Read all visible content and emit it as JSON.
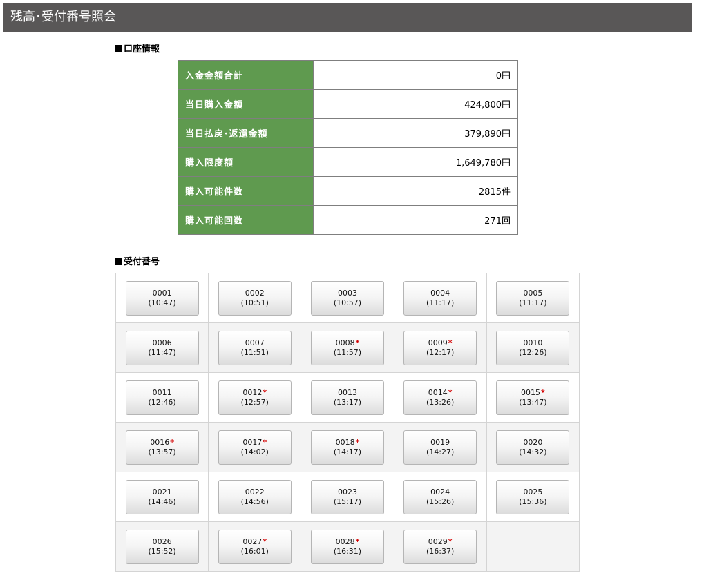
{
  "page_title": "残高･受付番号照会",
  "account_section": {
    "heading": "口座情報",
    "rows": [
      {
        "label": "入金金額合計",
        "value": "0円"
      },
      {
        "label": "当日購入金額",
        "value": "424,800円"
      },
      {
        "label": "当日払戻･返還金額",
        "value": "379,890円"
      },
      {
        "label": "購入限度額",
        "value": "1,649,780円"
      },
      {
        "label": "購入可能件数",
        "value": "2815件"
      },
      {
        "label": "購入可能回数",
        "value": "271回"
      }
    ]
  },
  "reception_section": {
    "heading": "受付番号",
    "star_mark": "*",
    "slots": [
      {
        "number": "0001",
        "time": "(10:47)",
        "starred": false
      },
      {
        "number": "0002",
        "time": "(10:51)",
        "starred": false
      },
      {
        "number": "0003",
        "time": "(10:57)",
        "starred": false
      },
      {
        "number": "0004",
        "time": "(11:17)",
        "starred": false
      },
      {
        "number": "0005",
        "time": "(11:17)",
        "starred": false
      },
      {
        "number": "0006",
        "time": "(11:47)",
        "starred": false
      },
      {
        "number": "0007",
        "time": "(11:51)",
        "starred": false
      },
      {
        "number": "0008",
        "time": "(11:57)",
        "starred": true
      },
      {
        "number": "0009",
        "time": "(12:17)",
        "starred": true
      },
      {
        "number": "0010",
        "time": "(12:26)",
        "starred": false
      },
      {
        "number": "0011",
        "time": "(12:46)",
        "starred": false
      },
      {
        "number": "0012",
        "time": "(12:57)",
        "starred": true
      },
      {
        "number": "0013",
        "time": "(13:17)",
        "starred": false
      },
      {
        "number": "0014",
        "time": "(13:26)",
        "starred": true
      },
      {
        "number": "0015",
        "time": "(13:47)",
        "starred": true
      },
      {
        "number": "0016",
        "time": "(13:57)",
        "starred": true
      },
      {
        "number": "0017",
        "time": "(14:02)",
        "starred": true
      },
      {
        "number": "0018",
        "time": "(14:17)",
        "starred": true
      },
      {
        "number": "0019",
        "time": "(14:27)",
        "starred": false
      },
      {
        "number": "0020",
        "time": "(14:32)",
        "starred": false
      },
      {
        "number": "0021",
        "time": "(14:46)",
        "starred": false
      },
      {
        "number": "0022",
        "time": "(14:56)",
        "starred": false
      },
      {
        "number": "0023",
        "time": "(15:17)",
        "starred": false
      },
      {
        "number": "0024",
        "time": "(15:26)",
        "starred": false
      },
      {
        "number": "0025",
        "time": "(15:36)",
        "starred": false
      },
      {
        "number": "0026",
        "time": "(15:52)",
        "starred": false
      },
      {
        "number": "0027",
        "time": "(16:01)",
        "starred": true
      },
      {
        "number": "0028",
        "time": "(16:31)",
        "starred": true
      },
      {
        "number": "0029",
        "time": "(16:37)",
        "starred": true
      }
    ]
  }
}
